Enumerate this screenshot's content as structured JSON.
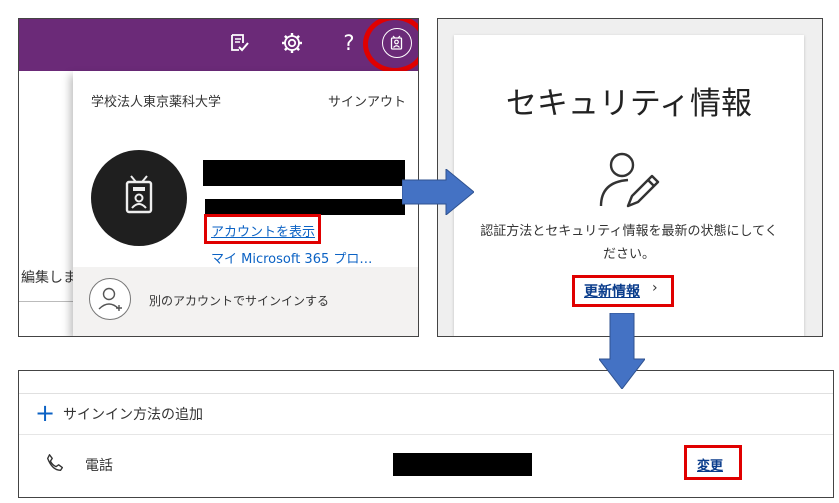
{
  "account_menu": {
    "org_name": "学校法人東京薬科大学",
    "sign_out": "サインアウト",
    "view_account": "アカウントを表示",
    "my_microsoft_365": "マイ Microsoft 365 プロ…",
    "sign_in_other": "別のアカウントでサインインする",
    "background_text": "編集しま",
    "topbar_icons": [
      "feedback-icon",
      "gear-icon",
      "help-icon",
      "account-avatar-icon"
    ],
    "help_glyph": "?",
    "colors": {
      "topbar": "#6b2a78",
      "highlight": "#e00000",
      "link": "#0b62c4"
    }
  },
  "security_info": {
    "title": "セキュリティ情報",
    "description": "認証方法とセキュリティ情報を最新の状態にしてください。",
    "update_link": "更新情報",
    "chevron": "›"
  },
  "methods": {
    "add_plus": "+",
    "add_label": "サインイン方法の追加",
    "phone_label": "電話",
    "change_link": "変更"
  },
  "arrows": {
    "color": "#4472c4"
  }
}
